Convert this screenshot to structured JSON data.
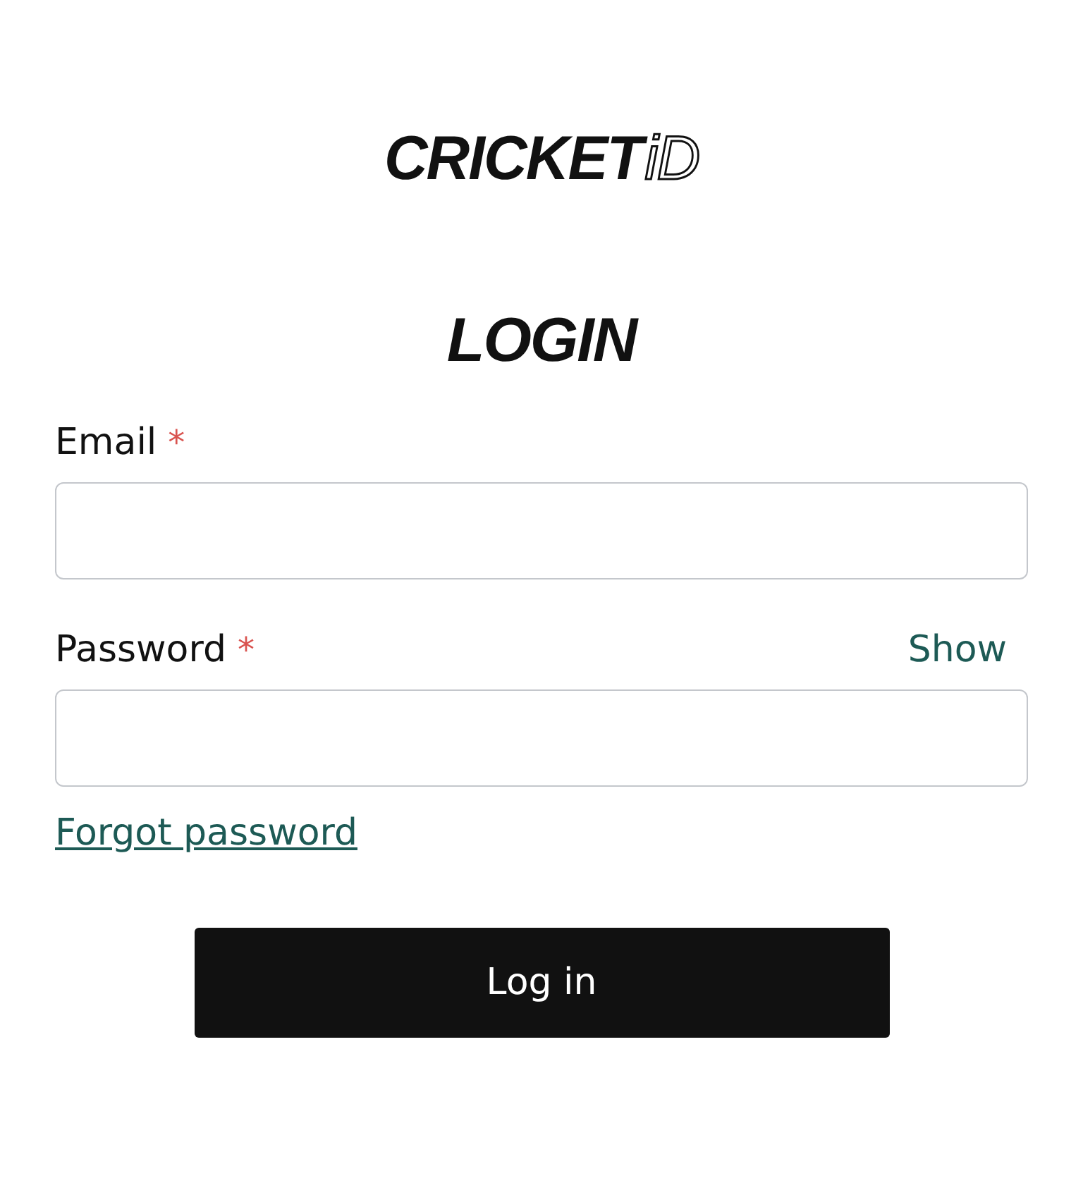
{
  "logo": {
    "text": "CRICKET",
    "outlined": "iD"
  },
  "heading": "LOGIN",
  "fields": [
    {
      "label": "Email",
      "required": "*"
    },
    {
      "label": "Password",
      "required": "*",
      "toggle": "Show"
    }
  ],
  "forgot_link": "Forgot password",
  "submit_button": "Log in"
}
